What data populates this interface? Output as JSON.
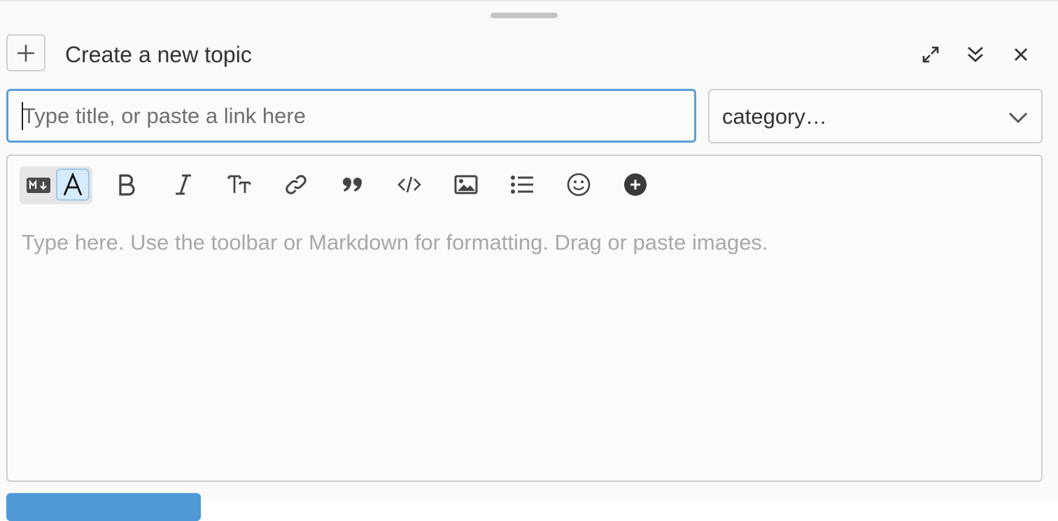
{
  "composer": {
    "header": {
      "title": "Create a new topic"
    },
    "title_input": {
      "placeholder": "Type title, or paste a link here",
      "value": ""
    },
    "category": {
      "selected": "category…"
    },
    "toolbar": {
      "modes": [
        "markdown-mode",
        "rich-text-mode"
      ],
      "active_mode": "rich-text-mode",
      "buttons": [
        "bold-icon",
        "italic-icon",
        "heading-icon",
        "link-icon",
        "quote-icon",
        "code-icon",
        "image-icon",
        "bullet-list-icon",
        "emoji-icon",
        "add-more-icon"
      ]
    },
    "editor": {
      "placeholder": "Type here. Use the toolbar or Markdown for formatting. Drag or paste images."
    },
    "colors": {
      "accent": "#4f9ad6",
      "focus_border": "#5a9fd4",
      "rich_mode_bg": "#d6ebfb"
    }
  }
}
